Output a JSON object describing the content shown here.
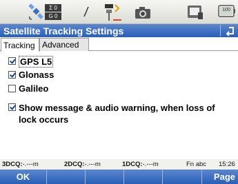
{
  "toolbar": {
    "icons": [
      "satellite-icon",
      "rover-base-icon",
      "radio-signal-icon",
      "survey-style-icon",
      "camera-icon",
      "controller-screen-icon",
      "battery-icon"
    ],
    "counter_labels": [
      "Σ 0",
      "G 0"
    ],
    "battery_label": "100"
  },
  "window": {
    "title": "Satellite Tracking Settings"
  },
  "tabs": [
    {
      "label": "Tracking",
      "active": true
    },
    {
      "label": "Advanced",
      "active": false
    }
  ],
  "options": [
    {
      "label": "GPS L5",
      "checked": true
    },
    {
      "label": "Glonass",
      "checked": true
    },
    {
      "label": "Galileo",
      "checked": false
    },
    {
      "label": "Show message & audio warning, when loss of lock occurs",
      "checked": true
    }
  ],
  "status": {
    "dcq3_label": "3DCQ:",
    "dcq3_value": "-.---m",
    "dcq2_label": "2DCQ:",
    "dcq2_value": "-.---m",
    "dcq1_label": "1DCQ:",
    "dcq1_value": "-.---m",
    "mode": "Fn  abc",
    "time": "15:26"
  },
  "softkeys": {
    "ok": "OK",
    "page": "Page"
  },
  "colors": {
    "title_bar": "#2a5fb8",
    "softkey_bar": "#2a5fb8",
    "toolbar_bg": "#e8e8e4"
  }
}
